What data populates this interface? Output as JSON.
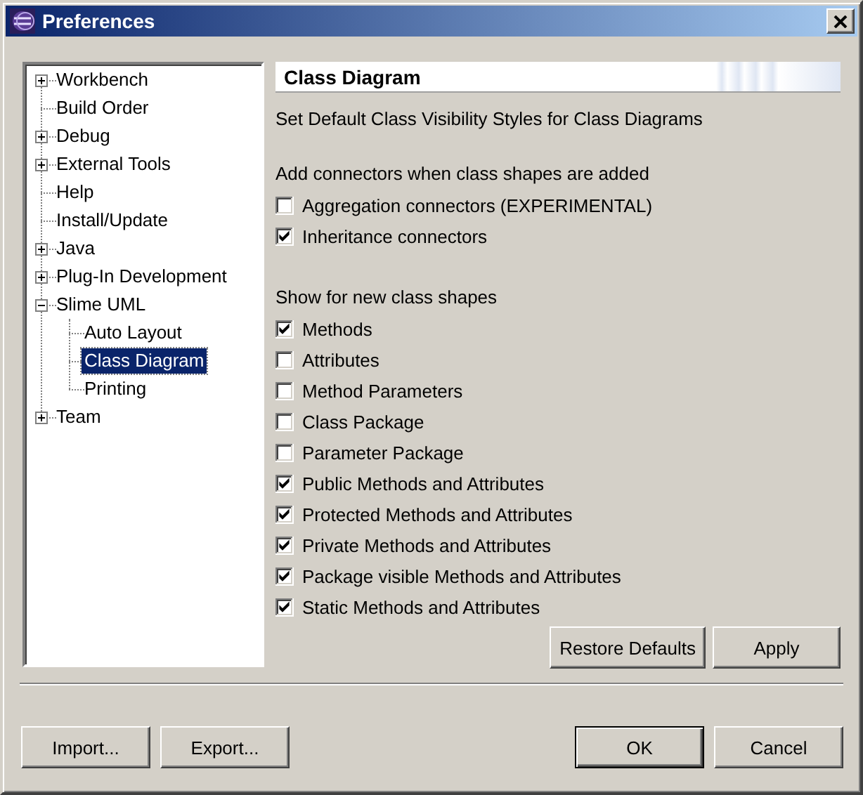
{
  "window": {
    "title": "Preferences"
  },
  "tree": [
    {
      "label": "Workbench",
      "expanded": false,
      "selected": false
    },
    {
      "label": "Build Order",
      "selected": false
    },
    {
      "label": "Debug",
      "expanded": false,
      "selected": false
    },
    {
      "label": "External Tools",
      "expanded": false,
      "selected": false
    },
    {
      "label": "Help",
      "selected": false
    },
    {
      "label": "Install/Update",
      "selected": false
    },
    {
      "label": "Java",
      "expanded": false,
      "selected": false
    },
    {
      "label": "Plug-In Development",
      "expanded": false,
      "selected": false
    },
    {
      "label": "Slime UML",
      "expanded": true,
      "selected": false,
      "children": [
        {
          "label": "Auto Layout",
          "selected": false
        },
        {
          "label": "Class Diagram",
          "selected": true
        },
        {
          "label": "Printing",
          "selected": false
        }
      ]
    },
    {
      "label": "Team",
      "expanded": false,
      "selected": false
    }
  ],
  "page": {
    "title": "Class Diagram",
    "description": "Set Default Class Visibility Styles for Class Diagrams",
    "groups": [
      {
        "label": "Add connectors when class shapes are added",
        "options": [
          {
            "label": "Aggregation connectors (EXPERIMENTAL)",
            "checked": false
          },
          {
            "label": "Inheritance connectors",
            "checked": true
          }
        ]
      },
      {
        "label": "Show for new class shapes",
        "options": [
          {
            "label": "Methods",
            "checked": true
          },
          {
            "label": "Attributes",
            "checked": false
          },
          {
            "label": "Method Parameters",
            "checked": false
          },
          {
            "label": "Class Package",
            "checked": false
          },
          {
            "label": "Parameter Package",
            "checked": false
          },
          {
            "label": "Public Methods and Attributes",
            "checked": true
          },
          {
            "label": "Protected Methods and Attributes",
            "checked": true
          },
          {
            "label": "Private Methods and Attributes",
            "checked": true
          },
          {
            "label": "Package visible Methods and Attributes",
            "checked": true
          },
          {
            "label": "Static Methods and Attributes",
            "checked": true
          }
        ]
      }
    ],
    "buttons": [
      "Restore Defaults",
      "Apply"
    ]
  },
  "left_buttons": [
    "Import...",
    "Export..."
  ],
  "dialog_buttons": [
    {
      "label": "OK",
      "default": true
    },
    {
      "label": "Cancel",
      "default": false
    }
  ]
}
